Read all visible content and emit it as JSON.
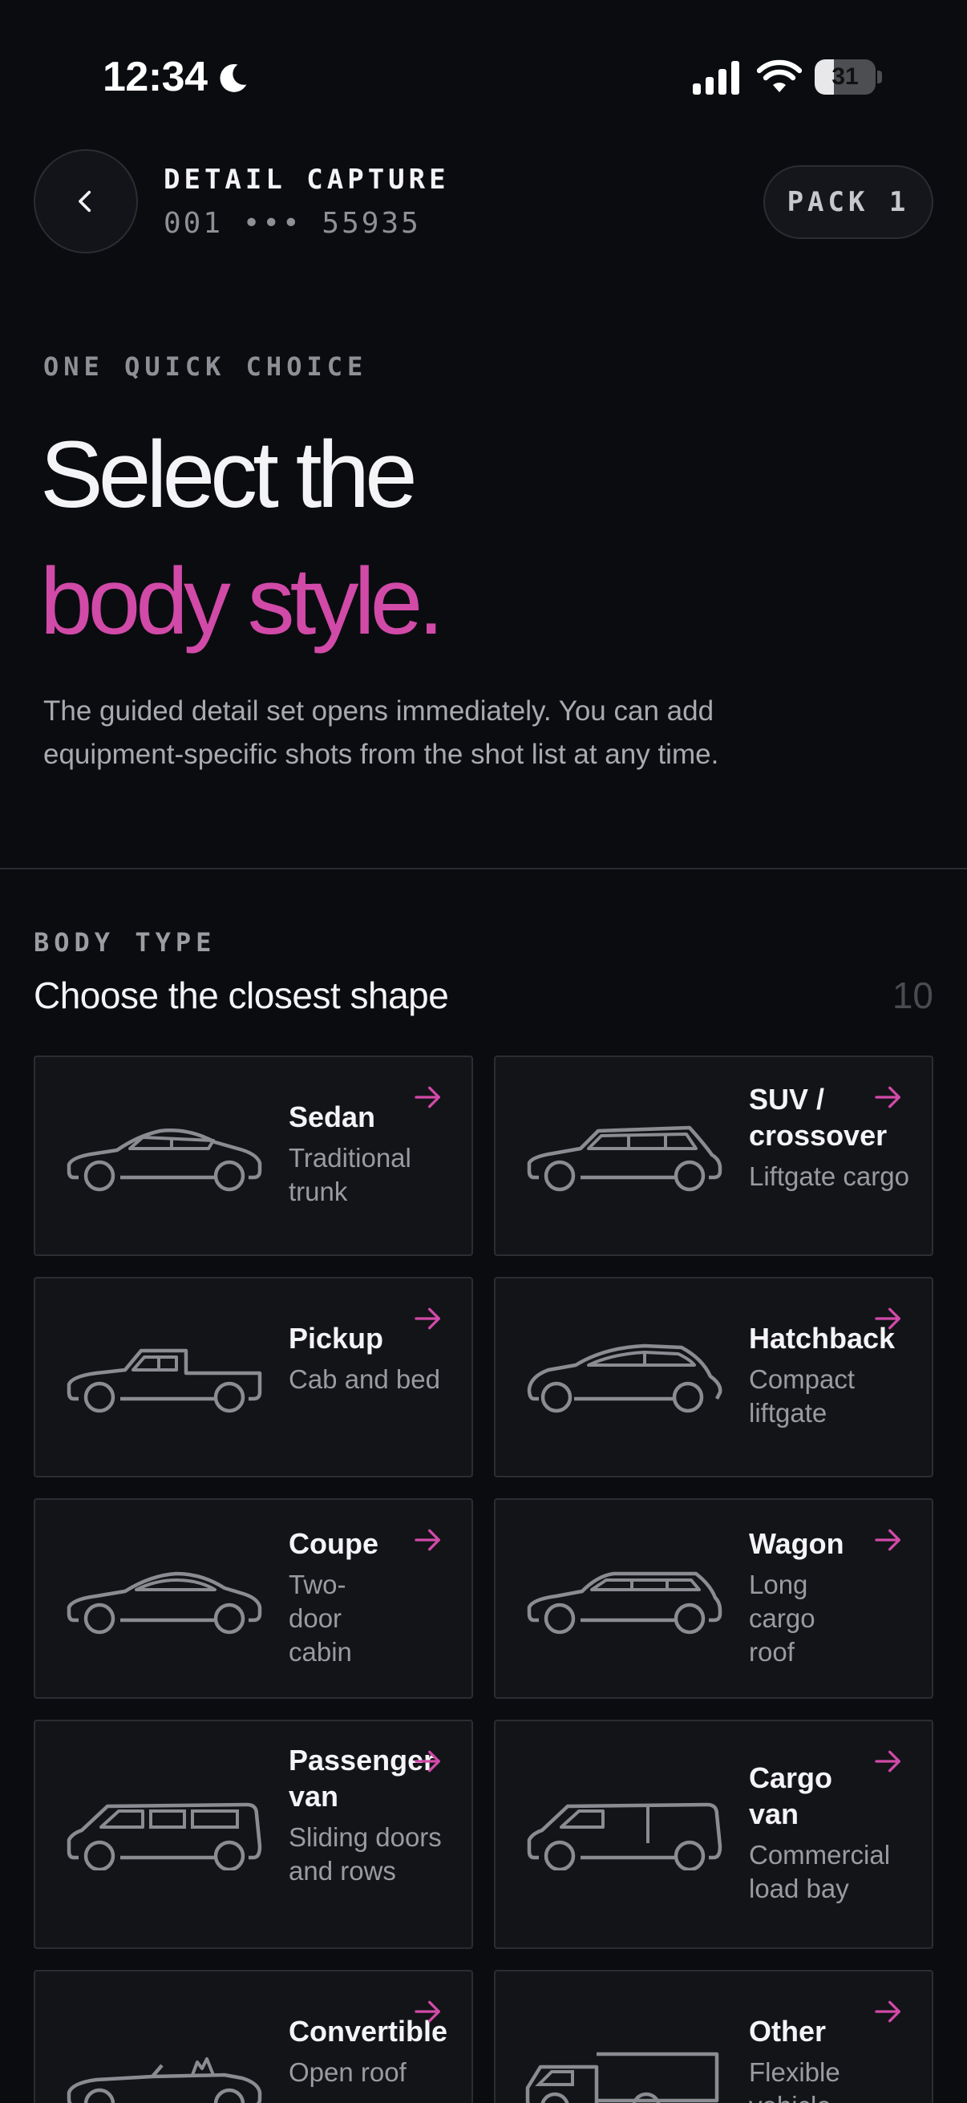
{
  "status_bar": {
    "time": "12:34",
    "battery": "31",
    "battery_fraction": 0.31,
    "icons": [
      "moon-icon",
      "signal-icon",
      "wifi-icon",
      "battery-icon"
    ]
  },
  "header": {
    "title": "DETAIL CAPTURE",
    "subtitle": "001 ••• 55935",
    "pack_label": "PACK 1"
  },
  "hero": {
    "eyebrow": "ONE QUICK CHOICE",
    "line1": "Select the",
    "line2": "body style.",
    "description": "The guided detail set opens immediately. You can add equipment-specific shots from the shot list at any time."
  },
  "section": {
    "label": "BODY TYPE",
    "title": "Choose the closest shape",
    "count": "10"
  },
  "body_types": [
    {
      "name": "Sedan",
      "desc": "Traditional trunk"
    },
    {
      "name": "SUV / crossover",
      "desc": "Liftgate cargo"
    },
    {
      "name": "Pickup",
      "desc": "Cab and bed"
    },
    {
      "name": "Hatchback",
      "desc": "Compact liftgate"
    },
    {
      "name": "Coupe",
      "desc": "Two-door cabin"
    },
    {
      "name": "Wagon",
      "desc": "Long cargo roof"
    },
    {
      "name": "Passenger van",
      "desc": "Sliding doors and rows"
    },
    {
      "name": "Cargo van",
      "desc": "Commercial load bay"
    },
    {
      "name": "Convertible",
      "desc": "Open roof"
    },
    {
      "name": "Other",
      "desc": "Flexible vehicle"
    }
  ],
  "colors": {
    "accent": "#d14aa8",
    "background": "#0b0c10",
    "card": "#131418",
    "icon_stroke": "#8a8c92"
  }
}
